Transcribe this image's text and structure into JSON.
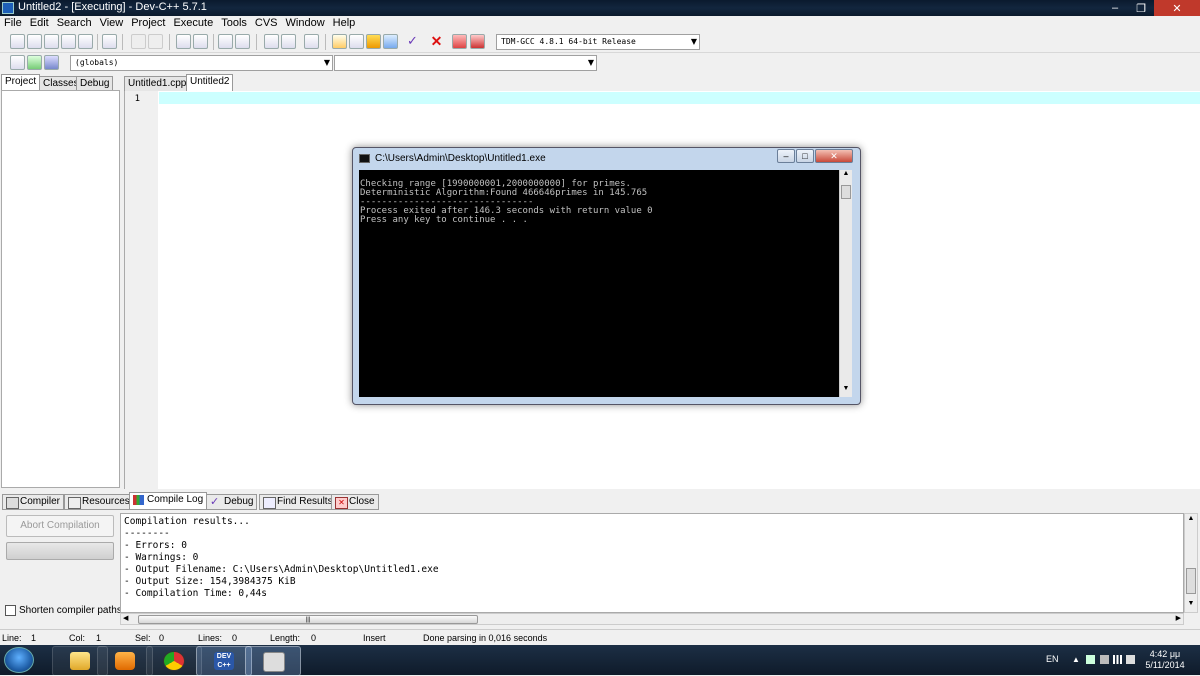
{
  "window": {
    "title": "Untitled2 - [Executing] - Dev-C++ 5.7.1"
  },
  "menu": [
    "File",
    "Edit",
    "Search",
    "View",
    "Project",
    "Execute",
    "Tools",
    "CVS",
    "Window",
    "Help"
  ],
  "toolbar": {
    "compiler_select": "TDM-GCC 4.8.1 64-bit Release",
    "scope_select": "(globals)",
    "member_select": ""
  },
  "left_tabs": [
    "Project",
    "Classes",
    "Debug"
  ],
  "editor_tabs": [
    "Untitled1.cpp",
    "Untitled2"
  ],
  "editor": {
    "line_number": "1"
  },
  "console": {
    "title": "C:\\Users\\Admin\\Desktop\\Untitled1.exe",
    "lines": [
      "Checking range [1990000001,2000000000] for primes.",
      "Deterministic Algorithm:Found 466646primes in 145.765",
      "--------------------------------",
      "Process exited after 146.3 seconds with return value 0",
      "Press any key to continue . . ."
    ]
  },
  "bottom_tabs": [
    "Compiler",
    "Resources",
    "Compile Log",
    "Debug",
    "Find Results",
    "Close"
  ],
  "bottom_left": {
    "abort_label": "Abort Compilation",
    "shorten_label": "Shorten compiler paths"
  },
  "compile_log": [
    "Compilation results...",
    "--------",
    "- Errors: 0",
    "- Warnings: 0",
    "- Output Filename: C:\\Users\\Admin\\Desktop\\Untitled1.exe",
    "- Output Size: 154,3984375 KiB",
    "- Compilation Time: 0,44s"
  ],
  "status": {
    "line_label": "Line:",
    "line_value": "1",
    "col_label": "Col:",
    "col_value": "1",
    "sel_label": "Sel:",
    "sel_value": "0",
    "lines_label": "Lines:",
    "lines_value": "0",
    "length_label": "Length:",
    "length_value": "0",
    "mode": "Insert",
    "message": "Done parsing in 0,016 seconds"
  },
  "taskbar": {
    "lang": "EN",
    "time": "4:42 μμ",
    "date": "5/11/2014"
  }
}
